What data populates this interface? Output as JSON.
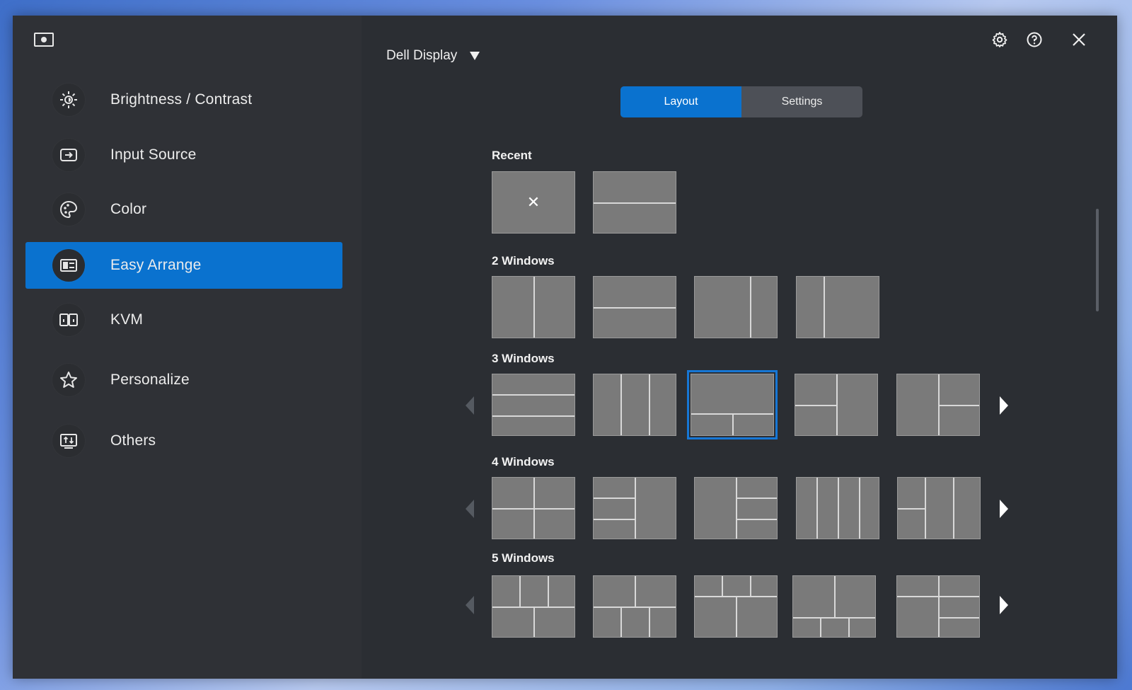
{
  "sidebar": {
    "items": [
      {
        "label": "Brightness / Contrast",
        "icon": "brightness-icon"
      },
      {
        "label": "Input Source",
        "icon": "input-source-icon"
      },
      {
        "label": "Color",
        "icon": "color-palette-icon"
      },
      {
        "label": "Easy Arrange",
        "icon": "easy-arrange-icon",
        "active": true
      },
      {
        "label": "KVM",
        "icon": "kvm-icon"
      },
      {
        "label": "Personalize",
        "icon": "star-icon"
      },
      {
        "label": "Others",
        "icon": "others-icon"
      }
    ]
  },
  "header": {
    "display_name": "Dell Display"
  },
  "tabs": {
    "layout": "Layout",
    "settings": "Settings",
    "active": "Layout"
  },
  "sections": {
    "recent": "Recent",
    "two": "2 Windows",
    "three": "3 Windows",
    "four": "4 Windows",
    "five": "5 Windows"
  },
  "colors": {
    "accent": "#0a72cf",
    "sidebar_bg": "#2f3136",
    "main_bg": "#2b2e33",
    "tile_bg": "#7a7a7a"
  }
}
